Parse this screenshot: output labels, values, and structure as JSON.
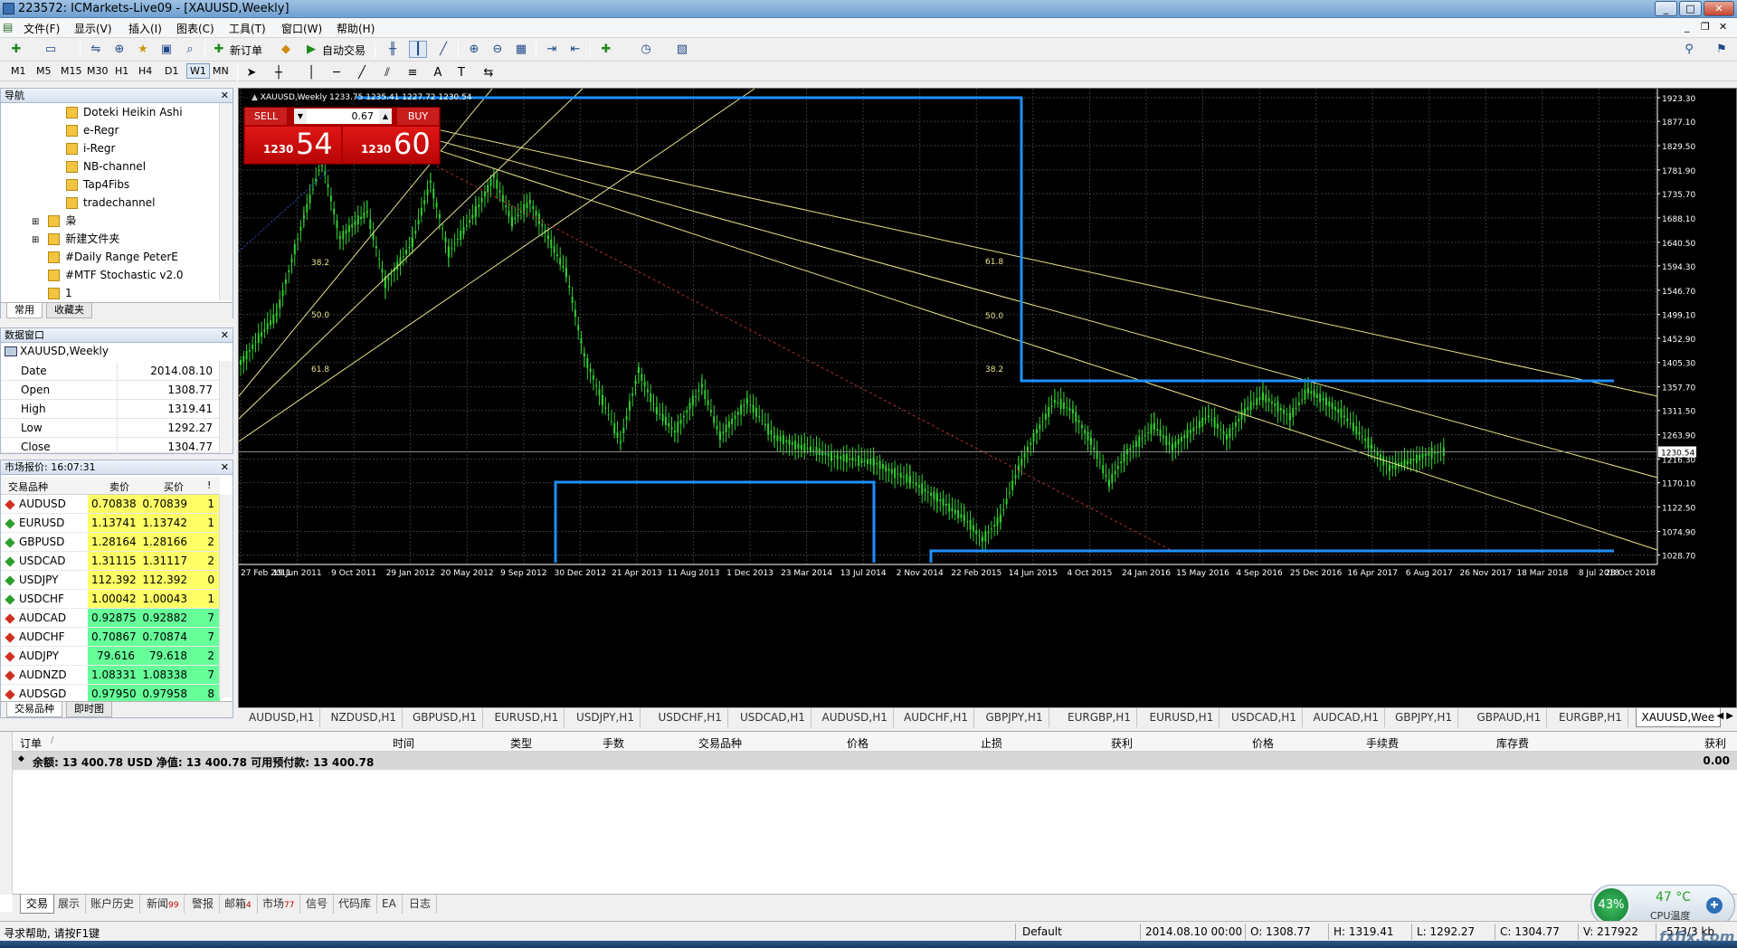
{
  "app": {
    "title": "223572: ICMarkets-Live09 - [XAUUSD,Weekly]",
    "min": "0",
    "max": "1",
    "close": "r",
    "watermark": "fxfix.com"
  },
  "menu": [
    "文件(F)",
    "显示(V)",
    "插入(I)",
    "图表(C)",
    "工具(T)",
    "窗口(W)",
    "帮助(H)"
  ],
  "toolbar": {
    "new_order": "新订单",
    "auto_trading": "自动交易"
  },
  "timeframes": [
    "M1",
    "M5",
    "M15",
    "M30",
    "H1",
    "H4",
    "D1",
    "W1",
    "MN"
  ],
  "selected_timeframe": "W1",
  "navigator": {
    "title": "导航",
    "items": [
      "Doteki Heikin Ashi",
      "e-Regr",
      "i-Regr",
      "NB-channel",
      "Tap4Fibs",
      "tradechannel",
      "枭",
      "新建文件夹",
      "#Daily Range PeterE",
      "#MTF Stochastic v2.0",
      "1"
    ],
    "tabs": [
      "常用",
      "收藏夹"
    ]
  },
  "data_window": {
    "title": "数据窗口",
    "symbol": "XAUUSD,Weekly",
    "rows": [
      {
        "k": "Date",
        "v": "2014.08.10"
      },
      {
        "k": "Open",
        "v": "1308.77"
      },
      {
        "k": "High",
        "v": "1319.41"
      },
      {
        "k": "Low",
        "v": "1292.27"
      },
      {
        "k": "Close",
        "v": "1304.77"
      }
    ]
  },
  "market_watch": {
    "title": "市场报价: 16:07:31",
    "headers": {
      "symbol": "交易品种",
      "bid": "卖价",
      "ask": "买价",
      "spread": "!"
    },
    "rows": [
      {
        "symbol": "AUDUSD",
        "bid": "0.70838",
        "ask": "0.70839",
        "spread": "1",
        "bg": "#ffff66",
        "dir": "down"
      },
      {
        "symbol": "EURUSD",
        "bid": "1.13741",
        "ask": "1.13742",
        "spread": "1",
        "bg": "#ffff66",
        "dir": "up"
      },
      {
        "symbol": "GBPUSD",
        "bid": "1.28164",
        "ask": "1.28166",
        "spread": "2",
        "bg": "#ffff66",
        "dir": "up"
      },
      {
        "symbol": "USDCAD",
        "bid": "1.31115",
        "ask": "1.31117",
        "spread": "2",
        "bg": "#ffff66",
        "dir": "up"
      },
      {
        "symbol": "USDJPY",
        "bid": "112.392",
        "ask": "112.392",
        "spread": "0",
        "bg": "#ffff66",
        "dir": "up"
      },
      {
        "symbol": "USDCHF",
        "bid": "1.00042",
        "ask": "1.00043",
        "spread": "1",
        "bg": "#ffff66",
        "dir": "up"
      },
      {
        "symbol": "AUDCAD",
        "bid": "0.92875",
        "ask": "0.92882",
        "spread": "7",
        "bg": "#66ff99",
        "dir": "down"
      },
      {
        "symbol": "AUDCHF",
        "bid": "0.70867",
        "ask": "0.70874",
        "spread": "7",
        "bg": "#66ff99",
        "dir": "down"
      },
      {
        "symbol": "AUDJPY",
        "bid": "79.616",
        "ask": "79.618",
        "spread": "2",
        "bg": "#66ff99",
        "dir": "down"
      },
      {
        "symbol": "AUDNZD",
        "bid": "1.08331",
        "ask": "1.08338",
        "spread": "7",
        "bg": "#66ff99",
        "dir": "down"
      },
      {
        "symbol": "AUDSGD",
        "bid": "0.97950",
        "ask": "0.97958",
        "spread": "8",
        "bg": "#66ff99",
        "dir": "down"
      }
    ],
    "tabs": [
      "交易品种",
      "即时图"
    ]
  },
  "chart": {
    "header": "XAUUSD,Weekly  1233.75 1235.41 1227.72 1230.54",
    "one_click": {
      "sell": "SELL",
      "buy": "BUY",
      "lot": "0.67",
      "sell_small": "1230",
      "sell_big": "54",
      "buy_small": "1230",
      "buy_big": "60"
    },
    "current_price": "1230.54",
    "price_labels": [
      "1923.30",
      "1877.10",
      "1829.50",
      "1781.90",
      "1735.70",
      "1688.10",
      "1640.50",
      "1594.30",
      "1546.70",
      "1499.10",
      "1452.90",
      "1405.30",
      "1357.70",
      "1311.50",
      "1263.90",
      "1216.30",
      "1170.10",
      "1122.50",
      "1074.90",
      "1028.70"
    ],
    "date_labels": [
      "27 Feb 2011",
      "19 Jun 2011",
      "9 Oct 2011",
      "29 Jan 2012",
      "20 May 2012",
      "9 Sep 2012",
      "30 Dec 2012",
      "21 Apr 2013",
      "11 Aug 2013",
      "1 Dec 2013",
      "23 Mar 2014",
      "13 Jul 2014",
      "2 Nov 2014",
      "22 Feb 2015",
      "14 Jun 2015",
      "4 Oct 2015",
      "24 Jan 2016",
      "15 May 2016",
      "4 Sep 2016",
      "25 Dec 2016",
      "16 Apr 2017",
      "6 Aug 2017",
      "26 Nov 2017",
      "18 Mar 2018",
      "8 Jul 2018",
      "28 Oct 2018"
    ],
    "fib_labels": [
      "38.2",
      "50.0",
      "61.8",
      "61.8",
      "50.0",
      "38.2"
    ],
    "colors": {
      "bull": "#33cc33",
      "bear": "#33cc33",
      "grid": "#3a3a3a",
      "box": "#1e90ff",
      "fib": "#e6e28a"
    }
  },
  "chart_tabs": [
    "AUDUSD,H1",
    "NZDUSD,H1",
    "GBPUSD,H1",
    "EURUSD,H1",
    "USDJPY,H1",
    "USDCHF,H1",
    "USDCAD,H1",
    "AUDUSD,H1",
    "AUDCHF,H1",
    "GBPJPY,H1",
    "EURGBP,H1",
    "EURUSD,H1",
    "USDCAD,H1",
    "AUDCAD,H1",
    "GBPJPY,H1",
    "GBPAUD,H1",
    "EURGBP,H1",
    "XAUUSD,Wee"
  ],
  "terminal": {
    "headers": [
      "订单",
      "/",
      "时间",
      "类型",
      "手数",
      "交易品种",
      "价格",
      "止损",
      "获利",
      "价格",
      "手续费",
      "库存费",
      "获利"
    ],
    "balance": "余额: 13 400.78 USD  净值: 13 400.78  可用预付款: 13 400.78",
    "balance_profit": "0.00",
    "tabs": [
      {
        "label": "交易",
        "badge": ""
      },
      {
        "label": "展示",
        "badge": ""
      },
      {
        "label": "账户历史",
        "badge": ""
      },
      {
        "label": "新闻",
        "badge": "99"
      },
      {
        "label": "警报",
        "badge": ""
      },
      {
        "label": "邮箱",
        "badge": "4"
      },
      {
        "label": "市场",
        "badge": "77"
      },
      {
        "label": "信号",
        "badge": ""
      },
      {
        "label": "代码库",
        "badge": ""
      },
      {
        "label": "EA",
        "badge": ""
      },
      {
        "label": "日志",
        "badge": ""
      }
    ]
  },
  "status": {
    "help": "寻求帮助, 请按F1键",
    "profile": "Default",
    "date": "2014.08.10 00:00",
    "open": "O: 1308.77",
    "high": "H: 1319.41",
    "low": "L: 1292.27",
    "close": "C: 1304.77",
    "volume": "V: 217922",
    "traffic": "573/3 kb"
  },
  "cpu": {
    "percent": "43%",
    "temp": "47 °C",
    "label": "CPU温度"
  }
}
